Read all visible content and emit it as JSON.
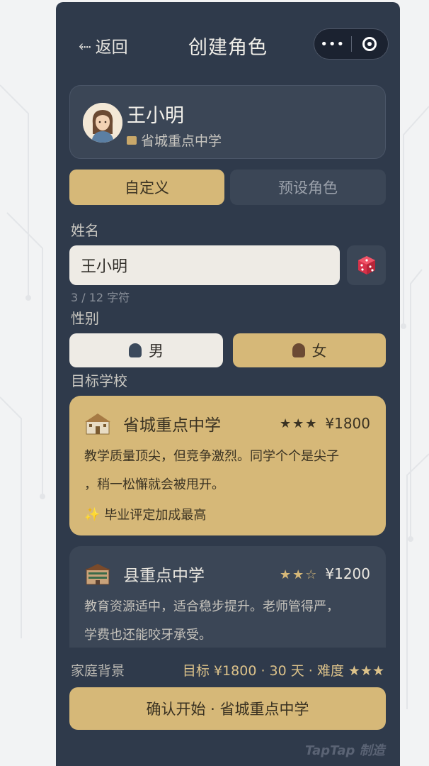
{
  "header": {
    "back_label": "返回",
    "title": "创建角色",
    "more_glyph": "•••",
    "back_glyph": "⬸"
  },
  "profile": {
    "name": "王小明",
    "school": "省城重点中学"
  },
  "tabs": [
    {
      "label": "自定义",
      "active": true
    },
    {
      "label": "预设角色",
      "active": false
    }
  ],
  "form": {
    "name_label": "姓名",
    "name_value": "王小明",
    "name_counter": "3 / 12 字符",
    "gender_label": "性别",
    "gender_options": [
      {
        "label": "男",
        "selected": false
      },
      {
        "label": "女",
        "selected": true
      }
    ],
    "school_label": "目标学校"
  },
  "schools": [
    {
      "name": "省城重点中学",
      "stars": "★★★",
      "price": "¥1800",
      "desc_line1": "教学质量顶尖，但竞争激烈。同学个个是尖子",
      "desc_line2": "，稍一松懈就会被甩开。",
      "perk_icon": "✨",
      "perk": "毕业评定加成最高",
      "selected": true
    },
    {
      "name": "县重点中学",
      "stars": "★★☆",
      "price": "¥1200",
      "desc_line1": "教育资源适中，适合稳步提升。老师管得严，",
      "desc_line2": "学费也还能咬牙承受。",
      "selected": false
    }
  ],
  "footer": {
    "family_label": "家庭背景",
    "summary": "目标 ¥1800 · 30 天 · 难度 ★★★",
    "confirm_label": "确认开始 · 省城重点中学",
    "watermark": "TapTap 制造"
  },
  "colors": {
    "accent": "#d6b878",
    "panel": "#2f3a4b",
    "card": "#3b4656"
  }
}
